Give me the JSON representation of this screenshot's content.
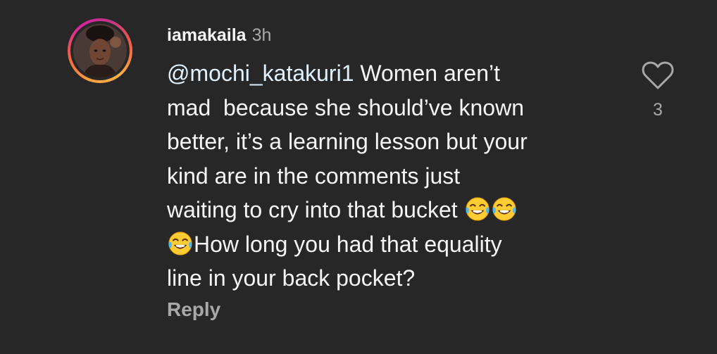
{
  "comment": {
    "username": "iamakaila",
    "timestamp": "3h",
    "mention": "@mochi_katakuri1",
    "lines": [
      " Women aren’t",
      "mad  because she should’ve known",
      "better, it’s a learning lesson but your",
      "kind are in the comments just",
      "waiting to cry into that bucket ",
      "How long you had that equality",
      "line in your back pocket?"
    ],
    "emoji_name": "face-with-tears-of-joy",
    "reply_label": "Reply",
    "like_count": "3"
  },
  "colors": {
    "background": "#272727",
    "text": "#f5f5f5",
    "secondary": "#a8a8a8",
    "mention": "#e0f1ff"
  },
  "icons": {
    "like": "heart-outline-icon",
    "emoji": "face-with-tears-of-joy-icon"
  }
}
